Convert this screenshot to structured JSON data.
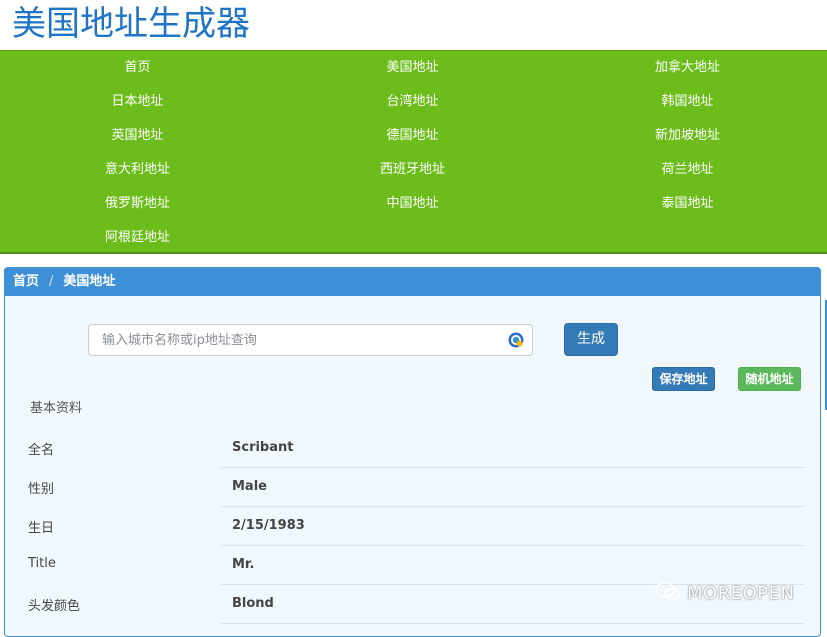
{
  "site": {
    "title": "美国地址生成器"
  },
  "nav": {
    "items": [
      "首页",
      "美国地址",
      "加拿大地址",
      "日本地址",
      "台湾地址",
      "韩国地址",
      "英国地址",
      "德国地址",
      "新加坡地址",
      "意大利地址",
      "西班牙地址",
      "荷兰地址",
      "俄罗斯地址",
      "中国地址",
      "泰国地址",
      "阿根廷地址"
    ]
  },
  "breadcrumb": {
    "home": "首页",
    "separator": "/",
    "current": "美国地址"
  },
  "search": {
    "placeholder": "输入城市名称或ip地址查询",
    "value": ""
  },
  "buttons": {
    "generate": "生成",
    "save": "保存地址",
    "random": "随机地址"
  },
  "profile": {
    "section_title": "基本资料",
    "rows": [
      {
        "label": "全名",
        "value": "Scribant"
      },
      {
        "label": "性别",
        "value": "Male"
      },
      {
        "label": "生日",
        "value": "2/15/1983"
      },
      {
        "label": "Title",
        "value": "Mr."
      },
      {
        "label": "头发颜色",
        "value": "Blond"
      }
    ]
  },
  "watermark": {
    "text": "MOREOPEN"
  },
  "colors": {
    "title_blue": "#1f74c6",
    "nav_green": "#6cbd1b",
    "panel_blue": "#3d8fd6",
    "primary_button": "#337ab7",
    "success_button": "#5cb85c"
  }
}
